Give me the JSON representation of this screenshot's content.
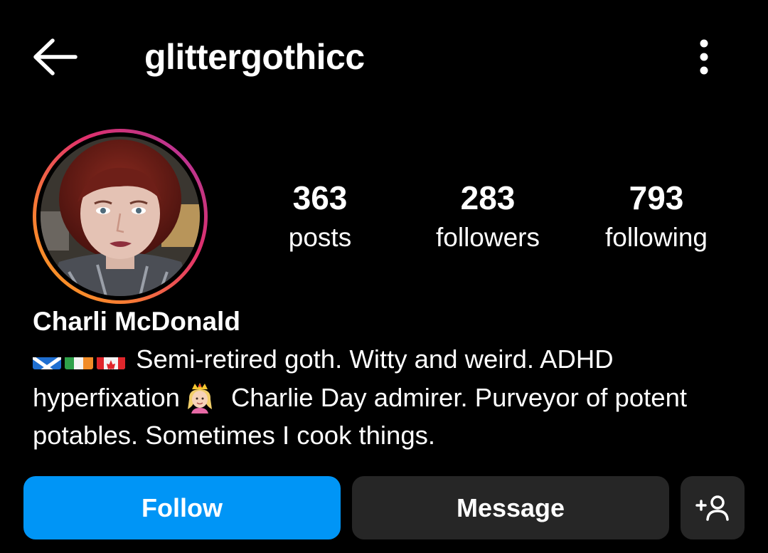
{
  "header": {
    "username": "glittergothicc",
    "back_icon": "arrow-left-icon",
    "more_icon": "more-vertical-icon"
  },
  "profile": {
    "display_name": "Charli McDonald",
    "avatar_icon": "profile-photo",
    "ring_colors": [
      "#f9a51a",
      "#e1306c",
      "#b626cf"
    ]
  },
  "stats": {
    "posts": {
      "count": "363",
      "label": "posts"
    },
    "followers": {
      "count": "283",
      "label": "followers"
    },
    "following": {
      "count": "793",
      "label": "following"
    }
  },
  "bio": {
    "flags": [
      "scotland-flag",
      "ireland-flag",
      "canada-flag"
    ],
    "line1_text": "Semi-retired goth. Witty and weird.  ADHD",
    "line2_before": "hyperfixation",
    "emoji": "princess-emoji",
    "line2_after": "Charlie Day admirer.  Purveyor of potent",
    "line3": "potables.  Sometimes I cook things."
  },
  "actions": {
    "follow_label": "Follow",
    "message_label": "Message",
    "add_icon": "add-person-icon"
  },
  "colors": {
    "background": "#000000",
    "follow_button": "#0095f6",
    "secondary_button": "#262626",
    "text": "#ffffff"
  }
}
